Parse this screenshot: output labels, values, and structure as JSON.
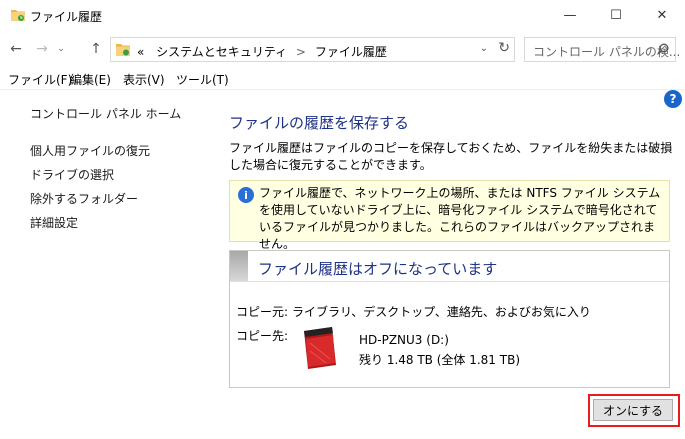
{
  "window": {
    "title": "ファイル履歴",
    "minimize_glyph": "—",
    "maximize_glyph": "☐",
    "close_glyph": "✕"
  },
  "nav": {
    "back_glyph": "←",
    "forward_glyph": "→",
    "recent_glyph": "⌄",
    "up_glyph": "↑"
  },
  "address": {
    "overflow": "«",
    "crumbs": [
      "システムとセキュリティ",
      "ファイル履歴"
    ],
    "separator": ">",
    "dropdown_glyph": "⌄",
    "refresh_glyph": "↻"
  },
  "search": {
    "placeholder": "コントロール パネルの検..."
  },
  "menu": {
    "items": [
      "ファイル(F)",
      "編集(E)",
      "表示(V)",
      "ツール(T)"
    ]
  },
  "help": {
    "glyph": "?"
  },
  "sidebar": {
    "home": "コントロール パネル ホーム",
    "items": [
      "個人用ファイルの復元",
      "ドライブの選択",
      "除外するフォルダー",
      "詳細設定"
    ]
  },
  "main": {
    "title": "ファイルの履歴を保存する",
    "description": "ファイル履歴はファイルのコピーを保存しておくため、ファイルを紛失または破損した場合に復元することができます。",
    "info": {
      "glyph": "i",
      "text": "ファイル履歴で、ネットワーク上の場所、または NTFS ファイル システムを使用していないドライブ上に、暗号化ファイル システムで暗号化されているファイルが見つかりました。これらのファイルはバックアップされません。"
    },
    "panel": {
      "title": "ファイル履歴はオフになっています",
      "copy_from_label": "コピー元:",
      "copy_from_value": "ライブラリ、デスクトップ、連絡先、およびお気に入り",
      "copy_to_label": "コピー先:",
      "drive_name": "HD-PZNU3 (D:)",
      "drive_space": "残り 1.48 TB (全体 1.81 TB)"
    },
    "turn_on_button": "オンにする"
  },
  "colors": {
    "link_blue": "#1e3287",
    "info_bg": "#ffffe1",
    "highlight_red": "#e81c1c",
    "help_blue": "#1a66c8"
  }
}
